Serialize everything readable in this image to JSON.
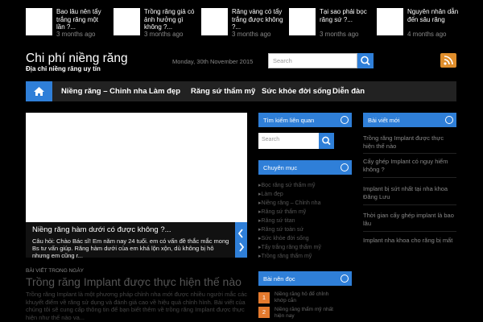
{
  "top_posts": [
    {
      "title": "Bao lâu nên tẩy trắng răng một lần ?...",
      "date": "3 months ago"
    },
    {
      "title": "Trồng răng giả có ảnh hưởng gì không ?...",
      "date": "3 months ago"
    },
    {
      "title": "Răng vàng có tẩy trắng được không ?...",
      "date": "3 months ago"
    },
    {
      "title": "Tại sao phải bọc răng sứ ?...",
      "date": "3 months ago"
    },
    {
      "title": "Nguyên nhân dẫn đến sâu răng",
      "date": "4 months ago"
    }
  ],
  "header": {
    "site_title": "Chi phí niềng răng",
    "tagline": "Địa chỉ niềng răng uy tín",
    "date": "Monday, 30th November 2015",
    "search_placeholder": "Search"
  },
  "nav": {
    "items": [
      "Niềng răng – Chỉnh nha",
      "Làm đẹp",
      "Răng sứ thẩm mỹ",
      "Sức khỏe đời sống",
      "Diễn đàn"
    ]
  },
  "slider": {
    "title": "Niềng răng hàm dưới có được không ?...",
    "text": "Câu hỏi: Chào Bác sĩ! Em năm nay 24 tuổi. em có vấn đề thắc mắc mong Bs tư vấn giúp. Răng hàm dưới của em khá lộn xộn, dù không bị hô nhưng em cũng r..."
  },
  "featured": {
    "label": "BÀI VIẾT TRONG NGÀY",
    "title": "Trồng răng Implant được thực hiện thế nào",
    "excerpt": "Trồng răng Implant là một phương pháp chỉnh nha mới được nhiều người mắc các khuyết điểm về răng sử dụng và đánh giá cao về hiệu quả chỉnh hình. Bài viết của chúng tôi sẽ cung cấp thông tin để bạn biết thêm về trồng răng Implant được thực hiện như thế nào va..."
  },
  "widgets": {
    "search": {
      "title": "Tìm kiếm liên quan",
      "placeholder": "Search"
    },
    "categories": {
      "title": "Chuyên mục",
      "items": [
        "Bọc răng sứ thẩm mỹ",
        "Làm đẹp",
        "Niềng răng – Chỉnh nha",
        "Răng sứ thẩm mỹ",
        "Răng sứ titan",
        "Răng sứ toàn sứ",
        "Sức khỏe đời sống",
        "Tẩy trắng răng thẩm mỹ",
        "Trồng răng thẩm mỹ"
      ]
    },
    "recommended": {
      "title": "Bài nên đọc",
      "items": [
        {
          "num": "1",
          "text": "Niềng răng hô để chỉnh khớp cắn"
        },
        {
          "num": "2",
          "text": "Niềng răng thẩm mỹ nhất hiện nay"
        }
      ]
    },
    "new_posts": {
      "title": "Bài viết mới",
      "items": [
        "Trồng răng Implant được thực hiện thế nào",
        "Cấy ghép Implant có nguy hiểm không ?",
        "Implant bị sứt nhất tại nha khoa Đăng Lưu",
        "Thời gian cấy ghép implant là bao lâu",
        "Implant nha khoa cho răng bị mất"
      ]
    }
  }
}
